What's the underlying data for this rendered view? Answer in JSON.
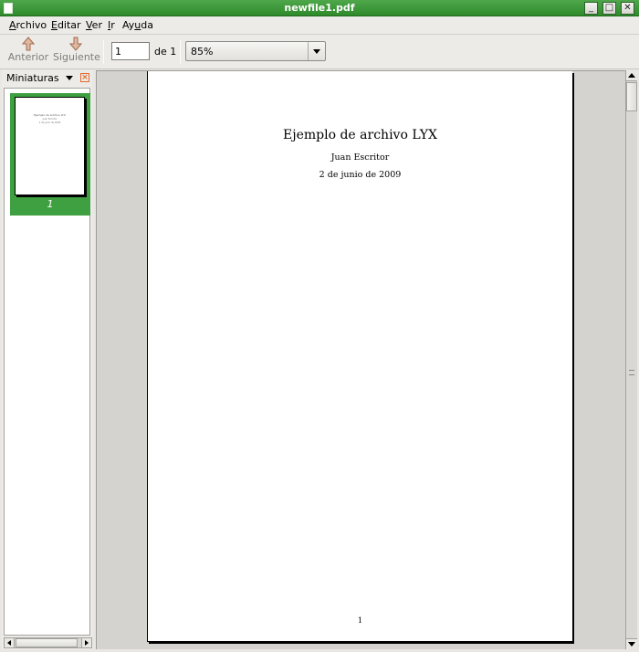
{
  "window": {
    "title": "newfile1.pdf",
    "minimize_icon": "minimize-icon",
    "maximize_icon": "maximize-icon",
    "close_icon": "close-icon"
  },
  "menu": {
    "items": [
      {
        "label": "Archivo",
        "accel": "A"
      },
      {
        "label": "Editar",
        "accel": "E"
      },
      {
        "label": "Ver",
        "accel": "V"
      },
      {
        "label": "Ir",
        "accel": "I"
      },
      {
        "label": "Ayuda",
        "accel": "u"
      }
    ]
  },
  "toolbar": {
    "prev_label": "Anterior",
    "next_label": "Siguiente",
    "page_value": "1",
    "of_pages": "de 1",
    "zoom_value": "85%"
  },
  "sidebar": {
    "header_label": "Miniaturas",
    "thumbnail_page_number": "1",
    "thumbnail_color": "#3ea040"
  },
  "document": {
    "title": "Ejemplo de archivo LYX",
    "author": "Juan Escritor",
    "date": "2 de junio de 2009",
    "page_number": "1"
  },
  "colors": {
    "titlebar": "#3e9b3b",
    "selection": "#3ea040"
  }
}
